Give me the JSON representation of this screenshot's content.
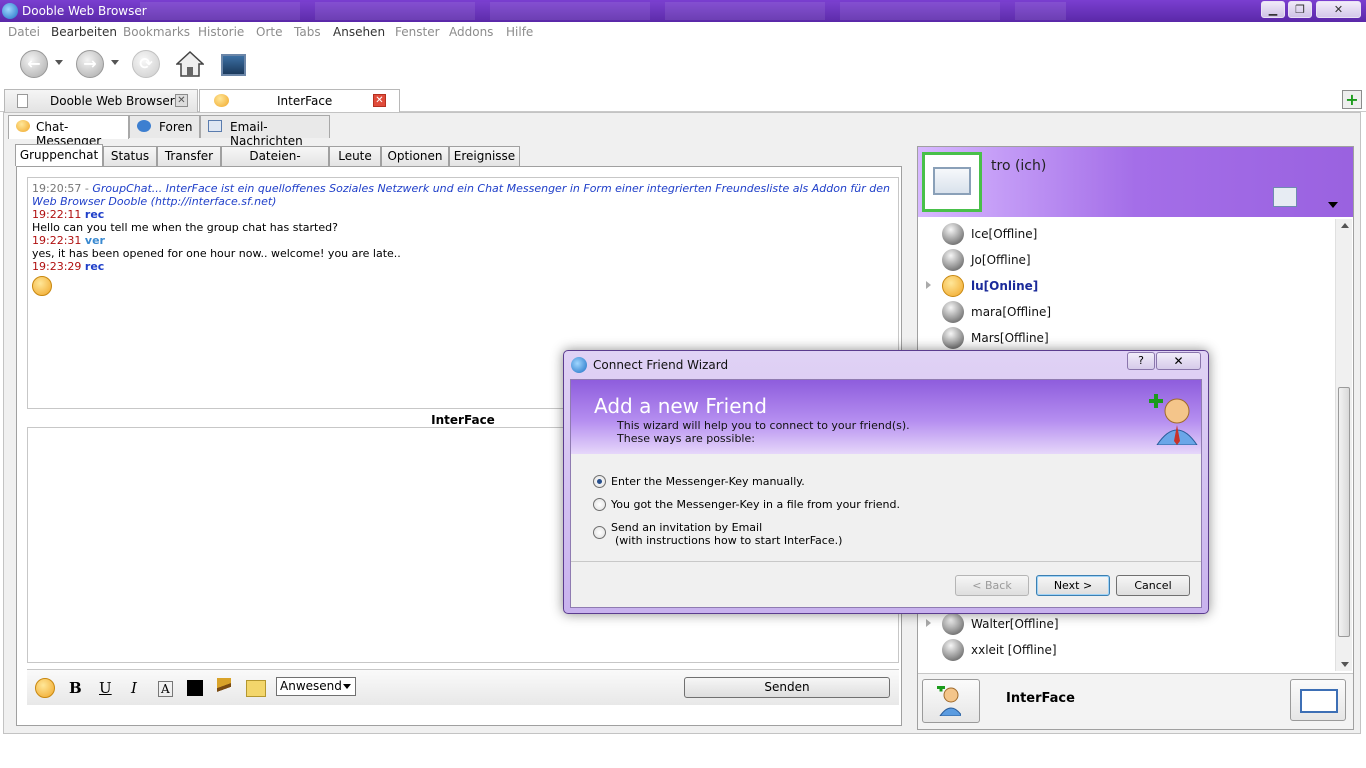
{
  "window": {
    "title": "Dooble Web Browser",
    "min": "▁",
    "max": "❐",
    "close": "✕"
  },
  "menu": [
    "Datei",
    "Bearbeiten",
    "Bookmarks",
    "Historie",
    "Orte",
    "Tabs",
    "Ansehen",
    "Fenster",
    "Addons",
    "Hilfe"
  ],
  "browser_tabs": [
    {
      "label": "Dooble Web Browser"
    },
    {
      "label": "InterFace"
    }
  ],
  "app_tabs": [
    "Chat-Messenger",
    "Foren",
    "Email-Nachrichten"
  ],
  "sub_tabs": [
    "Gruppenchat",
    "Status",
    "Transfer",
    "Dateien-Bibliothek",
    "Leute",
    "Optionen",
    "Ereignisse"
  ],
  "chat": {
    "line1_time": "19:20:57 -",
    "line1_text": "GroupChat... InterFace ist ein quelloffenes Soziales Netzwerk und ein Chat Messenger in Form einer integrierten Freundesliste als Addon für den Web Browser Dooble (http://interface.sf.net)",
    "messages": [
      {
        "time": "19:22:11",
        "user": "rec",
        "text": "Hello can you tell me when the group chat has started?"
      },
      {
        "time": "19:22:31",
        "user": "ver",
        "text": "yes, it has been opened for one hour now.. welcome! you are late.."
      },
      {
        "time": "19:23:29",
        "user": "rec",
        "text": ""
      }
    ],
    "input_label": "InterFace",
    "status_select": "Anwesend",
    "send_label": "Senden"
  },
  "profile": {
    "name": "tro (ich)"
  },
  "friends": [
    {
      "name": "Ice[Offline]",
      "online": false
    },
    {
      "name": "Jo[Offline]",
      "online": false
    },
    {
      "name": "lu[Online]",
      "online": true
    },
    {
      "name": "mara[Offline]",
      "online": false
    },
    {
      "name": "Mars[Offline]",
      "online": false
    },
    {
      "name": "Walter[Offline]",
      "online": false
    },
    {
      "name": "xxleit   [Offline]",
      "online": false
    }
  ],
  "right_bottom": {
    "label": "InterFace"
  },
  "dialog": {
    "title": "Connect Friend Wizard",
    "help": "?",
    "close": "✕",
    "heading": "Add a new Friend",
    "desc1": "This wizard will help you to connect to your friend(s).",
    "desc2": "These ways are possible:",
    "options": [
      {
        "label": "Enter the Messenger-Key manually.",
        "checked": true
      },
      {
        "label": "You got the Messenger-Key in a file from your friend.",
        "checked": false
      },
      {
        "label": "Send an invitation by Email",
        "sub": "(with instructions how to start InterFace.)",
        "checked": false
      }
    ],
    "back_label": "< Back",
    "next_label": "Next >",
    "cancel_label": "Cancel"
  },
  "colors": {
    "titlebar": "#6a33bd",
    "accent": "#9a62e0",
    "online": "#1a2a9a",
    "timestamp": "#b01010"
  }
}
